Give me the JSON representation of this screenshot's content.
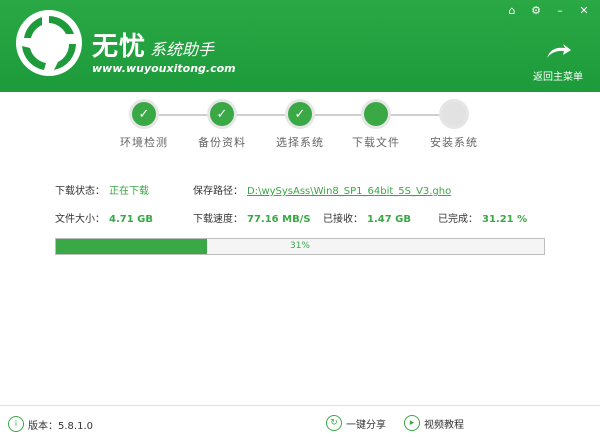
{
  "brand": {
    "title": "无忧",
    "subtitle": "系统助手",
    "url": "www.wuyouxitong.com"
  },
  "window": {
    "home_label": "返回主菜单"
  },
  "steps": [
    {
      "label": "环境检测",
      "state": "done"
    },
    {
      "label": "备份资料",
      "state": "done"
    },
    {
      "label": "选择系统",
      "state": "done"
    },
    {
      "label": "下载文件",
      "state": "current"
    },
    {
      "label": "安装系统",
      "state": "todo"
    }
  ],
  "download": {
    "status_label": "下载状态：",
    "status_value": "正在下载",
    "path_label": "保存路径：",
    "path_value": "D:\\wySysAss\\Win8_SP1_64bit_5S_V3.gho",
    "size_label": "文件大小：",
    "size_value": "4.71 GB",
    "speed_label": "下载速度：",
    "speed_value": "77.16 MB/S",
    "received_label": "已接收：",
    "received_value": "1.47 GB",
    "completed_label": "已完成：",
    "completed_value": "31.21 %",
    "progress_text": "31%",
    "progress_fraction": 0.31
  },
  "footer": {
    "version_label": "版本：5.8.1.0",
    "share_label": "一键分享",
    "video_label": "视频教程"
  },
  "colors": {
    "brand_green": "#1d9a3a",
    "accent_green": "#39a845"
  }
}
